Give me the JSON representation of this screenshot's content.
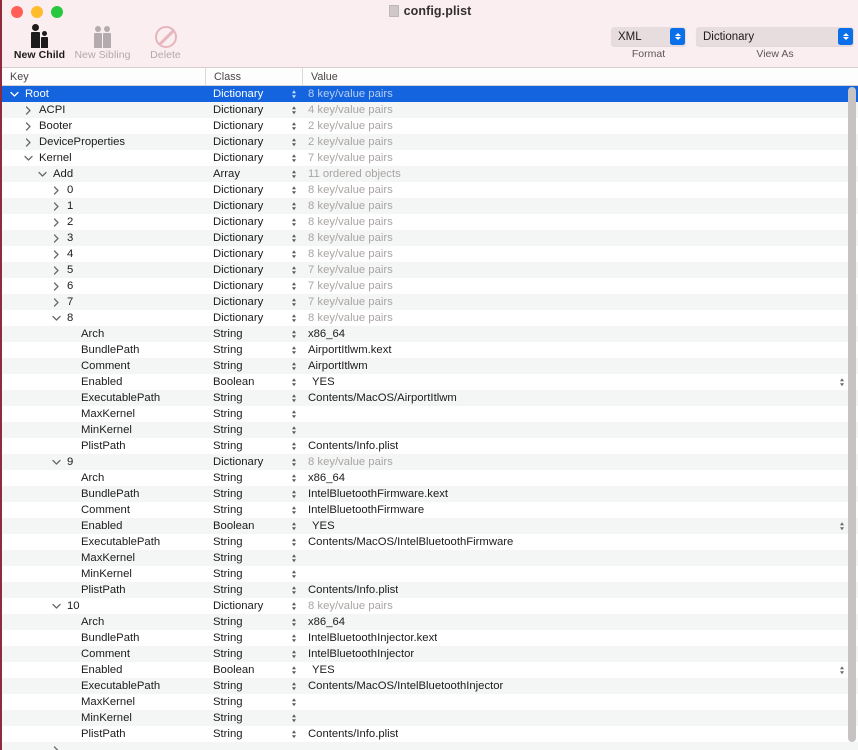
{
  "window": {
    "title": "config.plist",
    "title_icon": "document-icon",
    "traffic_lights": [
      {
        "name": "close-button",
        "color": "#ff5f57"
      },
      {
        "name": "minimize-button",
        "color": "#febc2e"
      },
      {
        "name": "maximize-button",
        "color": "#28c840"
      }
    ]
  },
  "toolbar": {
    "new_child": {
      "label": "New Child",
      "icon": "two-people-icon",
      "enabled": true
    },
    "new_sibling": {
      "label": "New Sibling",
      "icon": "two-people-icon",
      "enabled": false
    },
    "delete": {
      "label": "Delete",
      "icon": "no-entry-icon",
      "enabled": false
    },
    "format": {
      "caption": "Format",
      "value": "XML"
    },
    "view_as": {
      "caption": "View As",
      "value": "Dictionary"
    }
  },
  "table": {
    "columns": [
      "Key",
      "Class",
      "Value"
    ],
    "rows": [
      {
        "indent": 0,
        "twisty": "down",
        "key": "Root",
        "class": "Dictionary",
        "value": "8 key/value pairs",
        "muted": true,
        "selected": true
      },
      {
        "indent": 1,
        "twisty": "right",
        "key": "ACPI",
        "class": "Dictionary",
        "value": "4 key/value pairs",
        "muted": true
      },
      {
        "indent": 1,
        "twisty": "right",
        "key": "Booter",
        "class": "Dictionary",
        "value": "2 key/value pairs",
        "muted": true
      },
      {
        "indent": 1,
        "twisty": "right",
        "key": "DeviceProperties",
        "class": "Dictionary",
        "value": "2 key/value pairs",
        "muted": true
      },
      {
        "indent": 1,
        "twisty": "down",
        "key": "Kernel",
        "class": "Dictionary",
        "value": "7 key/value pairs",
        "muted": true
      },
      {
        "indent": 2,
        "twisty": "down",
        "key": "Add",
        "class": "Array",
        "value": "11 ordered objects",
        "muted": true
      },
      {
        "indent": 3,
        "twisty": "right",
        "key": "0",
        "class": "Dictionary",
        "value": "8 key/value pairs",
        "muted": true
      },
      {
        "indent": 3,
        "twisty": "right",
        "key": "1",
        "class": "Dictionary",
        "value": "8 key/value pairs",
        "muted": true
      },
      {
        "indent": 3,
        "twisty": "right",
        "key": "2",
        "class": "Dictionary",
        "value": "8 key/value pairs",
        "muted": true
      },
      {
        "indent": 3,
        "twisty": "right",
        "key": "3",
        "class": "Dictionary",
        "value": "8 key/value pairs",
        "muted": true
      },
      {
        "indent": 3,
        "twisty": "right",
        "key": "4",
        "class": "Dictionary",
        "value": "8 key/value pairs",
        "muted": true
      },
      {
        "indent": 3,
        "twisty": "right",
        "key": "5",
        "class": "Dictionary",
        "value": "7 key/value pairs",
        "muted": true
      },
      {
        "indent": 3,
        "twisty": "right",
        "key": "6",
        "class": "Dictionary",
        "value": "7 key/value pairs",
        "muted": true
      },
      {
        "indent": 3,
        "twisty": "right",
        "key": "7",
        "class": "Dictionary",
        "value": "7 key/value pairs",
        "muted": true
      },
      {
        "indent": 3,
        "twisty": "down",
        "key": "8",
        "class": "Dictionary",
        "value": "8 key/value pairs",
        "muted": true
      },
      {
        "indent": 4,
        "twisty": "none",
        "key": "Arch",
        "class": "String",
        "value": "x86_64"
      },
      {
        "indent": 4,
        "twisty": "none",
        "key": "BundlePath",
        "class": "String",
        "value": "AirportItlwm.kext"
      },
      {
        "indent": 4,
        "twisty": "none",
        "key": "Comment",
        "class": "String",
        "value": "AirportItlwm"
      },
      {
        "indent": 4,
        "twisty": "none",
        "key": "Enabled",
        "class": "Boolean",
        "value": "YES",
        "row_stepper": true
      },
      {
        "indent": 4,
        "twisty": "none",
        "key": "ExecutablePath",
        "class": "String",
        "value": "Contents/MacOS/AirportItlwm"
      },
      {
        "indent": 4,
        "twisty": "none",
        "key": "MaxKernel",
        "class": "String",
        "value": ""
      },
      {
        "indent": 4,
        "twisty": "none",
        "key": "MinKernel",
        "class": "String",
        "value": ""
      },
      {
        "indent": 4,
        "twisty": "none",
        "key": "PlistPath",
        "class": "String",
        "value": "Contents/Info.plist"
      },
      {
        "indent": 3,
        "twisty": "down",
        "key": "9",
        "class": "Dictionary",
        "value": "8 key/value pairs",
        "muted": true
      },
      {
        "indent": 4,
        "twisty": "none",
        "key": "Arch",
        "class": "String",
        "value": "x86_64"
      },
      {
        "indent": 4,
        "twisty": "none",
        "key": "BundlePath",
        "class": "String",
        "value": "IntelBluetoothFirmware.kext"
      },
      {
        "indent": 4,
        "twisty": "none",
        "key": "Comment",
        "class": "String",
        "value": "IntelBluetoothFirmware"
      },
      {
        "indent": 4,
        "twisty": "none",
        "key": "Enabled",
        "class": "Boolean",
        "value": "YES",
        "row_stepper": true
      },
      {
        "indent": 4,
        "twisty": "none",
        "key": "ExecutablePath",
        "class": "String",
        "value": "Contents/MacOS/IntelBluetoothFirmware"
      },
      {
        "indent": 4,
        "twisty": "none",
        "key": "MaxKernel",
        "class": "String",
        "value": ""
      },
      {
        "indent": 4,
        "twisty": "none",
        "key": "MinKernel",
        "class": "String",
        "value": ""
      },
      {
        "indent": 4,
        "twisty": "none",
        "key": "PlistPath",
        "class": "String",
        "value": "Contents/Info.plist"
      },
      {
        "indent": 3,
        "twisty": "down",
        "key": "10",
        "class": "Dictionary",
        "value": "8 key/value pairs",
        "muted": true
      },
      {
        "indent": 4,
        "twisty": "none",
        "key": "Arch",
        "class": "String",
        "value": "x86_64"
      },
      {
        "indent": 4,
        "twisty": "none",
        "key": "BundlePath",
        "class": "String",
        "value": "IntelBluetoothInjector.kext"
      },
      {
        "indent": 4,
        "twisty": "none",
        "key": "Comment",
        "class": "String",
        "value": "IntelBluetoothInjector"
      },
      {
        "indent": 4,
        "twisty": "none",
        "key": "Enabled",
        "class": "Boolean",
        "value": "YES",
        "row_stepper": true
      },
      {
        "indent": 4,
        "twisty": "none",
        "key": "ExecutablePath",
        "class": "String",
        "value": "Contents/MacOS/IntelBluetoothInjector"
      },
      {
        "indent": 4,
        "twisty": "none",
        "key": "MaxKernel",
        "class": "String",
        "value": ""
      },
      {
        "indent": 4,
        "twisty": "none",
        "key": "MinKernel",
        "class": "String",
        "value": ""
      },
      {
        "indent": 4,
        "twisty": "none",
        "key": "PlistPath",
        "class": "String",
        "value": "Contents/Info.plist"
      },
      {
        "indent": 3,
        "twisty": "right",
        "key": "",
        "class": "",
        "value": "",
        "partial": true
      }
    ]
  }
}
